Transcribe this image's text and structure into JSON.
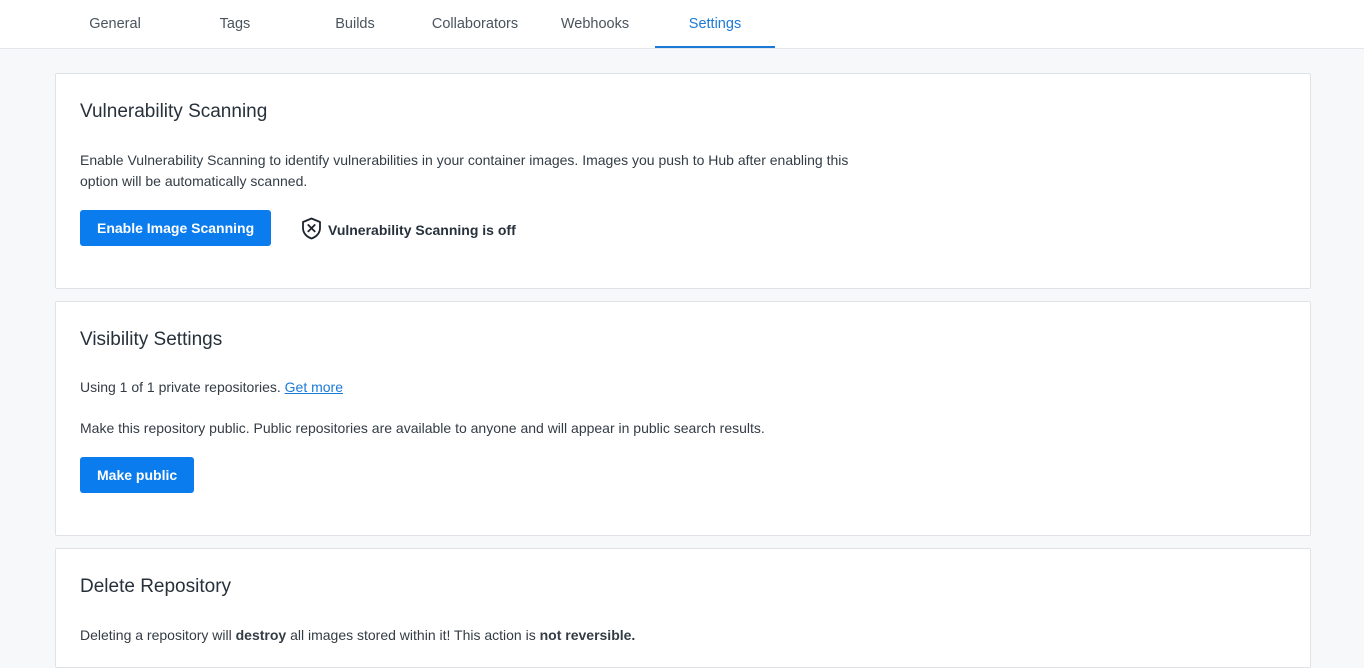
{
  "tabs": [
    {
      "label": "General",
      "active": false
    },
    {
      "label": "Tags",
      "active": false
    },
    {
      "label": "Builds",
      "active": false
    },
    {
      "label": "Collaborators",
      "active": false
    },
    {
      "label": "Webhooks",
      "active": false
    },
    {
      "label": "Settings",
      "active": true
    }
  ],
  "vulnerability": {
    "title": "Vulnerability Scanning",
    "description": "Enable Vulnerability Scanning to identify vulnerabilities in your container images. Images you push to Hub after enabling this option will be automatically scanned.",
    "button_label": "Enable Image Scanning",
    "status_text": "Vulnerability Scanning is off",
    "status_icon": "shield-x-icon"
  },
  "visibility": {
    "title": "Visibility Settings",
    "usage_text": "Using 1 of 1 private repositories.",
    "get_more_link": "Get more",
    "description": "Make this repository public. Public repositories are available to anyone and will appear in public search results.",
    "button_label": "Make public"
  },
  "delete": {
    "title": "Delete Repository",
    "text_1": "Deleting a repository will ",
    "text_bold_1": "destroy",
    "text_2": " all images stored within it! This action is ",
    "text_bold_2": "not reversible."
  },
  "colors": {
    "accent": "#0b7ced",
    "active_tab": "#1b7ad8",
    "background": "#f7f8fa"
  }
}
